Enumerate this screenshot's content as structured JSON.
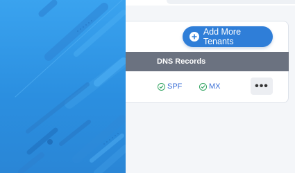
{
  "toolbar": {
    "add_button_label": "Add More Tenants"
  },
  "table": {
    "columns": [
      "DNS Records"
    ],
    "rows": [
      {
        "dns": [
          "SPF",
          "MX"
        ],
        "actions_label": "•••"
      }
    ]
  },
  "colors": {
    "accent": "#2f7ed8",
    "header_bg": "#6b7280",
    "panel_blue": "#3aa3ef",
    "ok_green": "#2fa35f"
  },
  "icons": {
    "add": "plus-circle-icon",
    "record_ok": "check-circle-icon",
    "more": "ellipsis-icon"
  }
}
